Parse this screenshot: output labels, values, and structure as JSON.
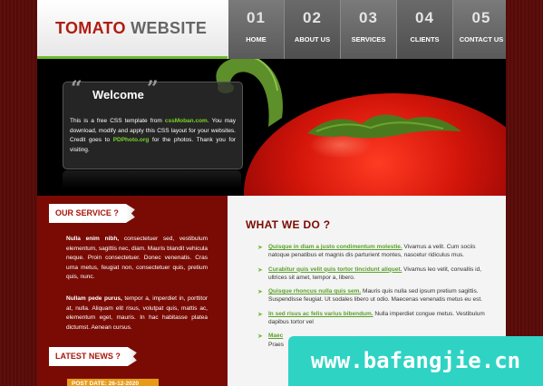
{
  "header": {
    "logo_part1": "TOMATO",
    "logo_part2": "WEBSITE"
  },
  "nav": [
    {
      "num": "01",
      "label": "HOME"
    },
    {
      "num": "02",
      "label": "ABOUT US"
    },
    {
      "num": "03",
      "label": "SERVICES"
    },
    {
      "num": "04",
      "label": "CLIENTS"
    },
    {
      "num": "05",
      "label": "CONTACT US"
    }
  ],
  "welcome": {
    "title": "Welcome",
    "text_1": "This is a free CSS template from ",
    "link_1": "cssMoban.com",
    "text_2": ". You may download, modify and apply this CSS layout for your websites. Credit goes to ",
    "link_2": "PDPhoto.org",
    "text_3": " for the photos. Thank you for visiting."
  },
  "sidebar": {
    "service_title": "OUR SERVICE ?",
    "p1_bold": "Nulla enim nibh,",
    "p1_text": " consectetuer sed, vestibulum elementum, sagittis nec, diam. Mauris blandit vehicula neque. Proin consectetuer. Donec venenatis. Cras urna metus, feugiat non, consectetuer quis, pretium quis, nunc.",
    "p2_bold": "Nullam pede purus,",
    "p2_text": " tempor a, imperdiet in, porttitor at, nulla. Aliquam elit risus, volutpat quis, mattis ac, elementum eget, mauris. In hac habitasse platea dictumst. Aenean cursus.",
    "news_title": "LATEST NEWS ?",
    "post_date": "POST DATE: 26-12-2020"
  },
  "main": {
    "title": "WHAT WE DO ?",
    "items": [
      {
        "link": "Quisque in diam a justo condimentum molestie.",
        "text": " Vivamus a velit. Cum sociis natoque penatibus et magnis dis parturient montes, nascetur ridiculus mus."
      },
      {
        "link": "Curabitur quis velit quis tortor tincidunt aliquet.",
        "text": " Vivamus leo velit, convallis id, ultrices sit amet, tempor a, libero."
      },
      {
        "link": "Quisque rhoncus nulla quis sem.",
        "text": " Mauris quis nulla sed ipsum pretium sagittis. Suspendisse feugiat. Ut sodales libero ut odio. Maecenas venenatis metus eu est."
      },
      {
        "link": "In sed risus ac felis varius bibendum.",
        "text": " Nulla imperdiet congue metus. Vestibulum dapibus tortor vel"
      },
      {
        "link": "Maec",
        "text": ""
      },
      {
        "link": "",
        "text": "Praes"
      }
    ]
  },
  "watermark": {
    "text": "www.bafangjie.cn"
  }
}
